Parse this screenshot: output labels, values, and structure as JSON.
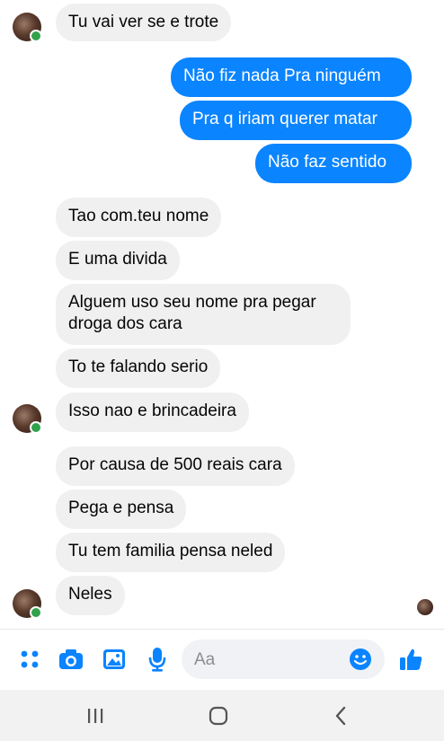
{
  "conversation": {
    "messages": [
      {
        "side": "in",
        "text": "Tu vai ver se e trote"
      },
      {
        "side": "out",
        "text": "Não fiz nada Pra ninguém"
      },
      {
        "side": "out",
        "text": "Pra q iriam querer matar"
      },
      {
        "side": "out",
        "text": "Não faz sentido"
      },
      {
        "side": "in",
        "text": "Tao com.teu nome"
      },
      {
        "side": "in",
        "text": "E uma divida"
      },
      {
        "side": "in",
        "text": "Alguem uso seu nome pra pegar droga dos cara"
      },
      {
        "side": "in",
        "text": "To te falando serio"
      },
      {
        "side": "in",
        "text": "Isso nao e brincadeira"
      },
      {
        "side": "in",
        "text": "Por causa de 500 reais cara"
      },
      {
        "side": "in",
        "text": "Pega e pensa"
      },
      {
        "side": "in",
        "text": "Tu tem familia pensa neled"
      },
      {
        "side": "in",
        "text": "Neles"
      }
    ]
  },
  "composer": {
    "placeholder": "Aa",
    "icons": [
      "apps-icon",
      "camera-icon",
      "gallery-icon",
      "microphone-icon",
      "emoji-icon",
      "like-icon"
    ]
  },
  "navigation": {
    "icons": [
      "recent-apps-icon",
      "home-icon",
      "back-icon"
    ]
  },
  "colors": {
    "outgoing_bubble": "#0a84ff",
    "incoming_bubble": "#f0f0f0",
    "accent": "#0a84ff",
    "online": "#31a24c"
  }
}
